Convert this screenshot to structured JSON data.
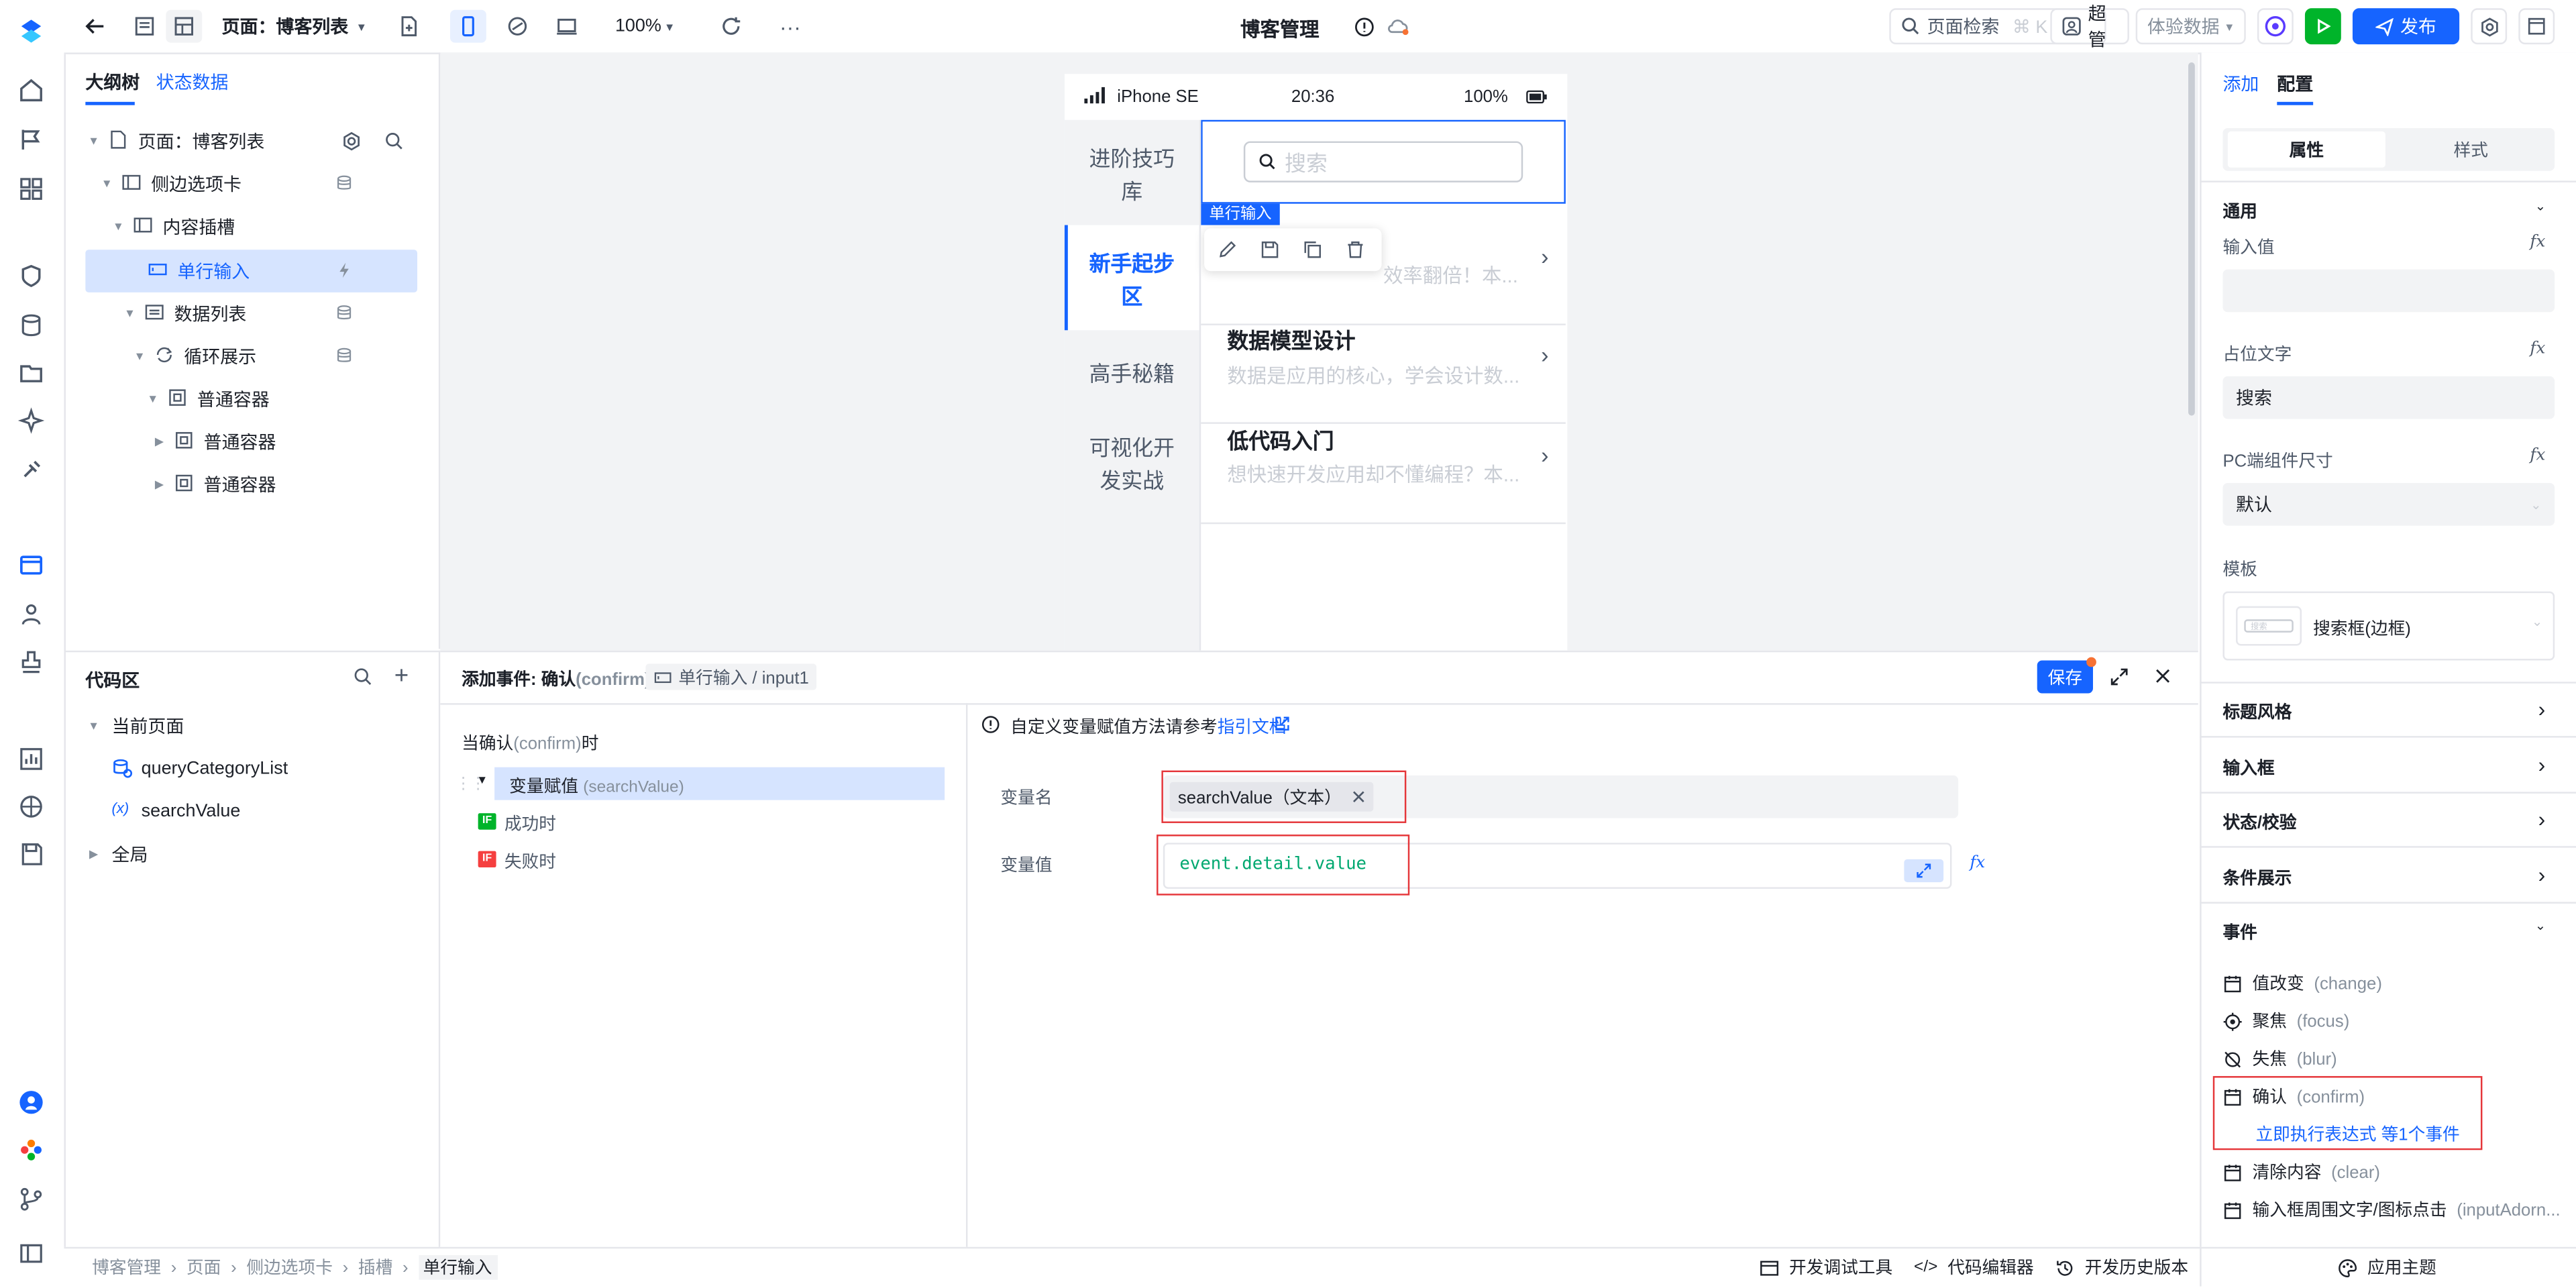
{
  "topbar": {
    "page_selector": "页面：博客列表",
    "zoom": "100%",
    "app_title": "博客管理",
    "search_label": "页面检索",
    "search_shortcut": "⌘ K",
    "user": "超管",
    "data_mode": "体验数据",
    "publish": "发布"
  },
  "outline": {
    "tabs": [
      "大纲树",
      "状态数据"
    ],
    "items": [
      {
        "label": "页面：博客列表"
      },
      {
        "label": "侧边选项卡"
      },
      {
        "label": "内容插槽"
      },
      {
        "label": "单行输入"
      },
      {
        "label": "数据列表"
      },
      {
        "label": "循环展示"
      },
      {
        "label": "普通容器"
      },
      {
        "label": "普通容器"
      },
      {
        "label": "普通容器"
      }
    ]
  },
  "phone": {
    "device": "iPhone SE",
    "time": "20:36",
    "battery": "100%",
    "side_tabs": [
      "进阶技巧库",
      "新手起步区",
      "高手秘籍",
      "可视化开发实战"
    ],
    "search_placeholder": "搜索",
    "selection_label": "单行输入",
    "list": [
      {
        "title": "",
        "desc": "效率翻倍！本..."
      },
      {
        "title": "数据模型设计",
        "desc": "数据是应用的核心，学会设计数..."
      },
      {
        "title": "低代码入门",
        "desc": "想快速开发应用却不懂编程？本..."
      }
    ]
  },
  "codearea": {
    "title": "代码区",
    "current_page": "当前页面",
    "items": [
      "queryCategoryList",
      "searchValue"
    ],
    "global": "全局"
  },
  "event": {
    "header_prefix": "添加事件: 确认",
    "header_event": "(confirm)",
    "component_path": "单行输入 / input1",
    "save": "保存",
    "trigger_prefix": "当确认",
    "trigger_event": "(confirm)",
    "trigger_suffix": "时",
    "action_label": "变量赋值",
    "action_code": "(searchValue)",
    "success": "成功时",
    "fail": "失败时",
    "hint": "自定义变量赋值方法请参考",
    "hint_link": "指引文档",
    "var_name_label": "变量名",
    "var_name_tag": "searchValue（文本）",
    "var_value_label": "变量值",
    "var_value": "event.detail.value"
  },
  "rpanel": {
    "tabs": [
      "添加",
      "配置"
    ],
    "segments": [
      "属性",
      "样式"
    ],
    "general": "通用",
    "input_value_label": "输入值",
    "placeholder_label": "占位文字",
    "placeholder_value": "搜索",
    "pc_size_label": "PC端组件尺寸",
    "pc_size_value": "默认",
    "template_label": "模板",
    "template_value": "搜索框(边框)",
    "template_thumb": "搜索",
    "sections": [
      "标题风格",
      "输入框",
      "状态/校验",
      "条件展示"
    ],
    "events_title": "事件",
    "events": [
      {
        "name": "值改变",
        "code": "(change)"
      },
      {
        "name": "聚焦",
        "code": "(focus)"
      },
      {
        "name": "失焦",
        "code": "(blur)"
      },
      {
        "name": "确认",
        "code": "(confirm)"
      },
      {
        "name": "清除内容",
        "code": "(clear)"
      },
      {
        "name": "输入框周围文字/图标点击",
        "code": "(inputAdorn..."
      }
    ],
    "confirm_summary": "立即执行表达式 等1个事件",
    "theme": "应用主题"
  },
  "statusbar": {
    "breadcrumb": [
      "博客管理",
      "页面",
      "侧边选项卡",
      "插槽",
      "单行输入"
    ],
    "tools": [
      "开发调试工具",
      "代码编辑器",
      "开发历史版本"
    ]
  },
  "colors": {
    "accent": "#1664ff",
    "highlight": "#d6e4ff",
    "danger": "#e5363a",
    "run": "#00b42a"
  }
}
